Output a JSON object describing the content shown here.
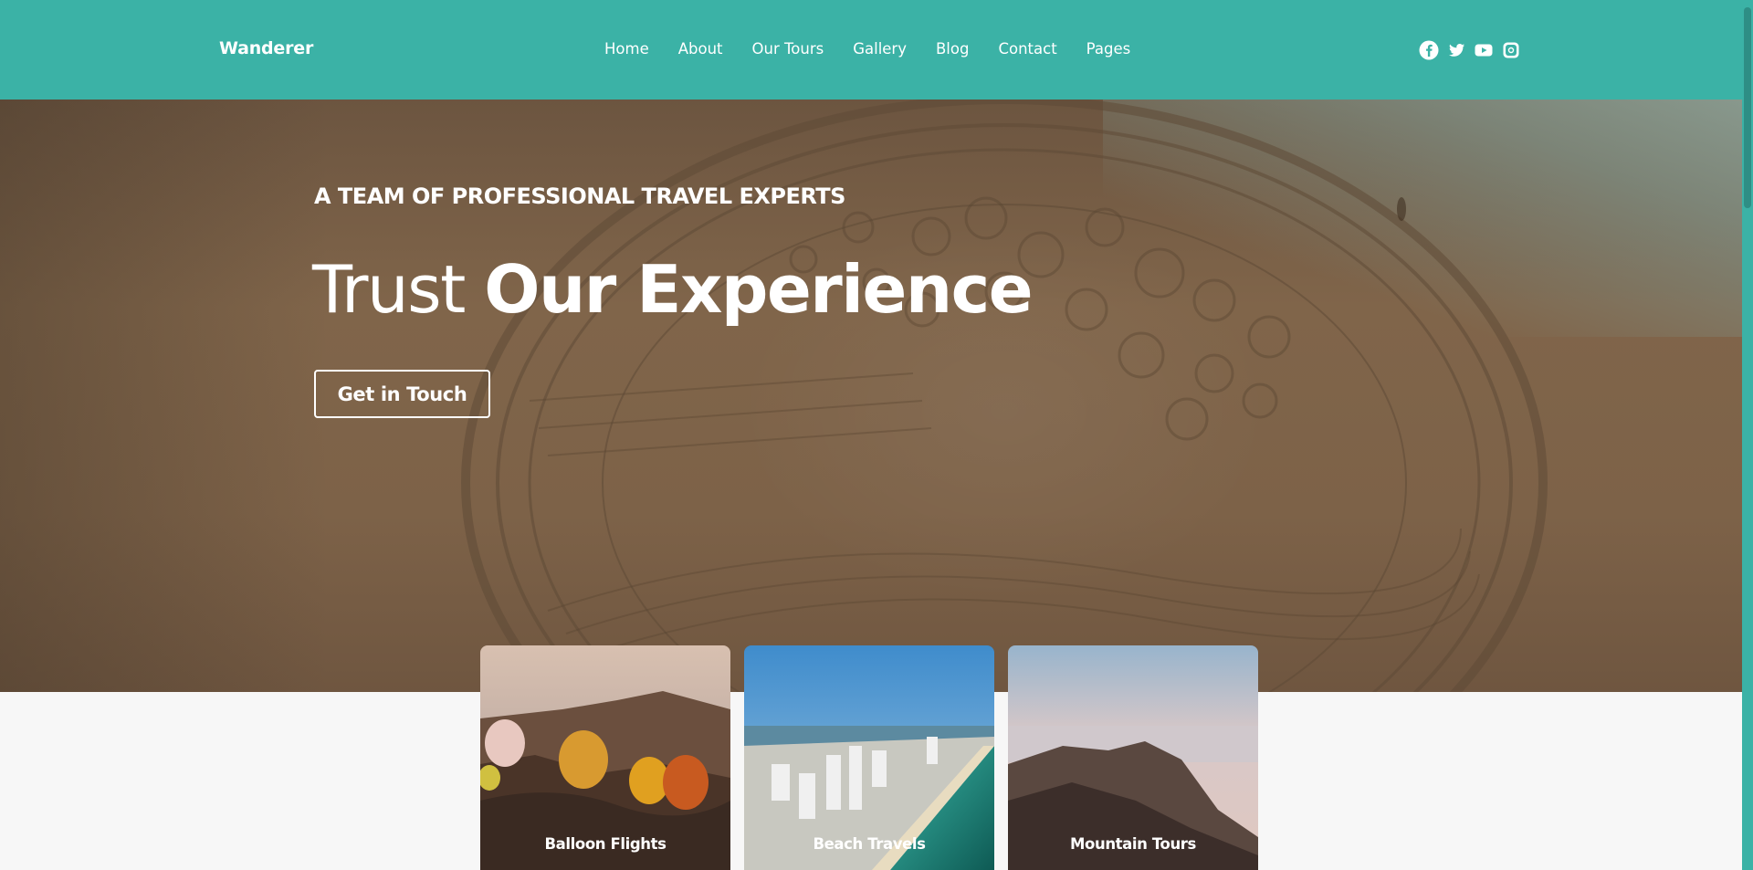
{
  "header": {
    "brand": "Wanderer",
    "nav": [
      "Home",
      "About",
      "Our Tours",
      "Gallery",
      "Blog",
      "Contact",
      "Pages"
    ],
    "socials": [
      "facebook-icon",
      "twitter-icon",
      "youtube-icon",
      "instagram-icon"
    ]
  },
  "hero": {
    "kicker": "A TEAM OF PROFESSIONAL TRAVEL EXPERTS",
    "title_light": "Trust ",
    "title_bold": "Our Experience",
    "cta": "Get in Touch"
  },
  "cards": [
    {
      "label": "Balloon Flights"
    },
    {
      "label": "Beach Travels"
    },
    {
      "label": "Mountain Tours"
    }
  ],
  "colors": {
    "accent": "#3bb2a6",
    "background": "#f7f7f7",
    "hero_sand": "#80654a"
  }
}
